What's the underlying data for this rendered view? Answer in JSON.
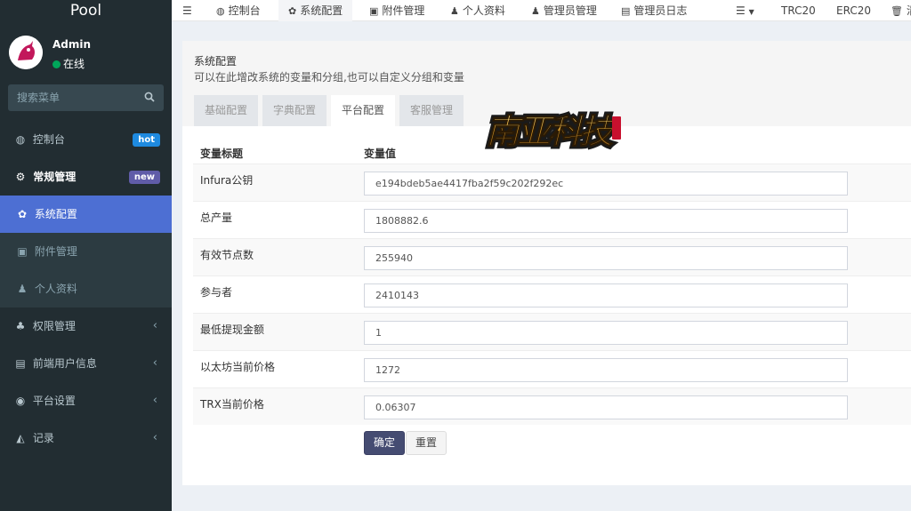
{
  "app": {
    "logo": "Pool"
  },
  "user": {
    "name": "Admin",
    "status": "在线"
  },
  "search": {
    "placeholder": "搜索菜单"
  },
  "sidebar": {
    "items": [
      {
        "label": "控制台",
        "badge": "hot"
      },
      {
        "label": "常规管理",
        "badge": "new"
      },
      {
        "label": "系统配置"
      },
      {
        "label": "附件管理"
      },
      {
        "label": "个人资料"
      },
      {
        "label": "权限管理"
      },
      {
        "label": "前端用户信息"
      },
      {
        "label": "平台设置"
      },
      {
        "label": "记录"
      }
    ]
  },
  "topnav": {
    "items": [
      {
        "label": "控制台"
      },
      {
        "label": "系统配置"
      },
      {
        "label": "附件管理"
      },
      {
        "label": "个人资料"
      },
      {
        "label": "管理员管理"
      },
      {
        "label": "管理员日志"
      }
    ],
    "right": [
      "TRC20",
      "ERC20",
      "清"
    ]
  },
  "page": {
    "title": "系统配置",
    "description": "可以在此增改系统的变量和分组,也可以自定义分组和变量"
  },
  "tabs": [
    "基础配置",
    "字典配置",
    "平台配置",
    "客服管理"
  ],
  "table": {
    "headers": [
      "变量标题",
      "变量值"
    ],
    "rows": [
      {
        "label": "Infura公钥",
        "value": "e194bdeb5ae4417fba2f59c202f292ec"
      },
      {
        "label": "总产量",
        "value": "1808882.6"
      },
      {
        "label": "有效节点数",
        "value": "255940"
      },
      {
        "label": "参与者",
        "value": "2410143"
      },
      {
        "label": "最低提现金额",
        "value": "1"
      },
      {
        "label": "以太坊当前价格",
        "value": "1272"
      },
      {
        "label": "TRX当前价格",
        "value": "0.06307"
      }
    ]
  },
  "buttons": {
    "ok": "确定",
    "reset": "重置"
  },
  "watermark": {
    "text": "南亚科技"
  },
  "colors": {
    "sidebar_bg": "#222d32",
    "active": "#4e6ed0",
    "badge_hot": "#1e8ae0",
    "badge_new": "#605ca8",
    "btn_ok": "#454c72"
  }
}
